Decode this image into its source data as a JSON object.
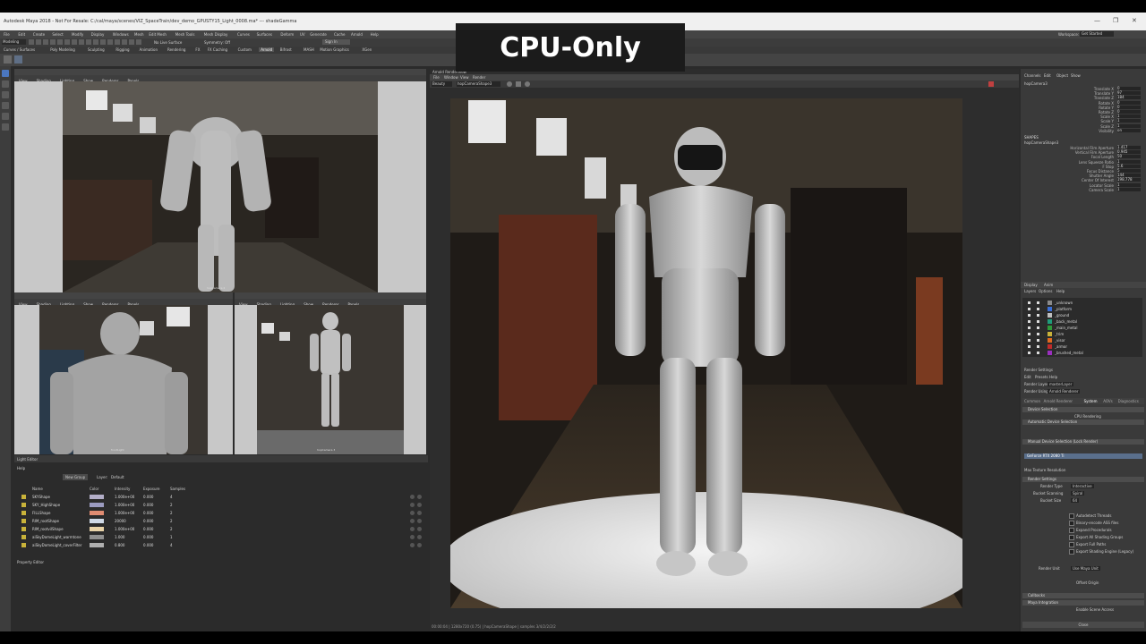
{
  "window": {
    "title": "Autodesk Maya 2018 - Not For Resale: C:/cal/maya/scenes/VIZ_SpaceTrain/dev_demo_GPUSTY15_Light_0008.ma*  ---  shadeGamma",
    "controls": [
      "—",
      "❐",
      "✕"
    ]
  },
  "menubar": {
    "items": [
      "File",
      "Edit",
      "Create",
      "Select",
      "Modify",
      "Display",
      "Windows",
      "Mesh",
      "Edit Mesh",
      "Mesh Tools",
      "Mesh Display",
      "Curves",
      "Surfaces",
      "Deform",
      "UV",
      "Generate",
      "Cache",
      "Arnold",
      "Help"
    ],
    "workspace_label": "Workspace:",
    "workspace_value": "Get Started"
  },
  "statusline": {
    "mode": "Modeling",
    "no_live": "No Live Surface",
    "symmetry": "Symmetry: Off",
    "signin": "Sign In"
  },
  "shelf": {
    "tabs": [
      "Curves / Surfaces",
      "Poly Modeling",
      "Sculpting",
      "Rigging",
      "Animation",
      "Rendering",
      "FX",
      "FX Caching",
      "Custom",
      "Arnold",
      "Bifrost",
      "MASH",
      "Motion Graphics",
      "XGen"
    ],
    "active": "Arnold"
  },
  "viewports": {
    "top": {
      "menu": [
        "View",
        "Shading",
        "Lighting",
        "Show",
        "Renderer",
        "Panels"
      ],
      "camera": "hopCamera 2"
    },
    "bottom_left": {
      "menu": [
        "View",
        "Shading",
        "Lighting",
        "Show",
        "Renderer",
        "Panels"
      ],
      "camera": "frontLight"
    },
    "bottom_right": {
      "menu": [
        "View",
        "Shading",
        "Lighting",
        "Show",
        "Renderer",
        "Panels"
      ],
      "camera": "hopCamera 3"
    }
  },
  "overlay": {
    "label": "CPU-Only"
  },
  "render_view": {
    "title": "Arnold RenderView",
    "menu": [
      "File",
      "Window",
      "View",
      "Render"
    ],
    "camera_select": "hopCameraShape3",
    "aov": "Beauty",
    "status": "00:00:04 | 1280x720 (0.75) | hopCameraShape | samples 3/4/2/2/2/2"
  },
  "light_editor": {
    "title": "Light Editor",
    "menu": "Help",
    "new_group": "New Group",
    "layer_label": "Layer:",
    "layer_value": "Default",
    "columns": [
      "Name",
      "Color",
      "Intensity",
      "Exposure",
      "Samples"
    ],
    "rows": [
      {
        "name": "SKYShape",
        "color": "#b3aec8",
        "intensity": "1.000e+00",
        "exposure": "0.000",
        "samples": "4"
      },
      {
        "name": "SKY_HighShape",
        "color": "#9b9bc0",
        "intensity": "1.000e+00",
        "exposure": "0.000",
        "samples": "2"
      },
      {
        "name": "FILLShape",
        "color": "#e08c72",
        "intensity": "1.000e+00",
        "exposure": "0.000",
        "samples": "2"
      },
      {
        "name": "RIM_rootShape",
        "color": "#cfd9e6",
        "intensity": "20000",
        "exposure": "0.000",
        "samples": "2"
      },
      {
        "name": "RIM_rootvilShape",
        "color": "#e8d3a8",
        "intensity": "1.000e+00",
        "exposure": "0.000",
        "samples": "2"
      },
      {
        "name": "aiSkyDomeLight_warmtone",
        "color": "#8f8f8f",
        "intensity": "1.000",
        "exposure": "0.000",
        "samples": "1"
      },
      {
        "name": "aiSkyDomeLight_coverFilter",
        "color": "#b0b0b0",
        "intensity": "0.800",
        "exposure": "0.000",
        "samples": "4"
      }
    ]
  },
  "property_editor": {
    "title": "Property Editor"
  },
  "channel_box": {
    "tabs": [
      "Channels",
      "Edit",
      "Object",
      "Show"
    ],
    "object": "hopCamera3",
    "channels": [
      {
        "name": "Translate X",
        "value": "0"
      },
      {
        "name": "Translate Y",
        "value": "97"
      },
      {
        "name": "Translate Z",
        "value": "184"
      },
      {
        "name": "Rotate X",
        "value": "0"
      },
      {
        "name": "Rotate Y",
        "value": "0"
      },
      {
        "name": "Rotate Z",
        "value": "0"
      },
      {
        "name": "Scale X",
        "value": "1"
      },
      {
        "name": "Scale Y",
        "value": "1"
      },
      {
        "name": "Scale Z",
        "value": "1"
      },
      {
        "name": "Visibility",
        "value": "on"
      }
    ],
    "shapes_label": "SHAPES",
    "shape_name": "hopCameraShape3",
    "shape_channels": [
      {
        "name": "Horizontal Film Aperture",
        "value": "1.417"
      },
      {
        "name": "Vertical Film Aperture",
        "value": "0.945"
      },
      {
        "name": "Focal Length",
        "value": "50"
      },
      {
        "name": "Lens Squeeze Ratio",
        "value": "1"
      },
      {
        "name": "F Stop",
        "value": "5.6"
      },
      {
        "name": "Focus Distance",
        "value": "5"
      },
      {
        "name": "Shutter Angle",
        "value": "144"
      },
      {
        "name": "Center Of Interest",
        "value": "198.778"
      },
      {
        "name": "Locator Scale",
        "value": "1"
      },
      {
        "name": "Camera Scale",
        "value": "1"
      }
    ]
  },
  "layers": {
    "tabs": [
      "Display",
      "Anim"
    ],
    "menu": [
      "Layers",
      "Options",
      "Help"
    ],
    "items": [
      {
        "name": "_unknown",
        "color": "#8a8a8a"
      },
      {
        "name": "_platform",
        "color": "#3a6fd8"
      },
      {
        "name": "_ground",
        "color": "#bfbfbf"
      },
      {
        "name": "_back_metal",
        "color": "#1f9c7c"
      },
      {
        "name": "_main_metal",
        "color": "#2f9a3a"
      },
      {
        "name": "_trim",
        "color": "#c9b23a"
      },
      {
        "name": "_visor",
        "color": "#e06a20"
      },
      {
        "name": "_armor",
        "color": "#c22a2a"
      },
      {
        "name": "_brushed_metal",
        "color": "#9b2fbf"
      }
    ]
  },
  "render_settings": {
    "title": "Render Settings",
    "menu": [
      "Edit",
      "Presets",
      "Help"
    ],
    "render_layer_label": "Render Layer",
    "render_layer_value": "masterLayer",
    "render_using_label": "Render Using",
    "render_using_value": "Arnold Renderer",
    "tabs": [
      "Common",
      "Arnold Renderer",
      "System",
      "AOVs",
      "Diagnostics"
    ],
    "active_tab": "System",
    "sections": [
      {
        "label": "Device Selection"
      },
      {
        "label": "Automatic Device Selection"
      },
      {
        "label": "Manual Device Selection (Lock Render)"
      },
      {
        "label": "Render Settings"
      },
      {
        "label": "Callbacks"
      },
      {
        "label": "Maya Integration"
      }
    ],
    "cpu_rendering": "CPU Rendering",
    "gpu_device": "GeForce RTX 2080 Ti",
    "max_texture_resolution": "Max Texture Resolution",
    "render_type_label": "Render Type",
    "render_type_value": "Interactive",
    "bucket_scanning_label": "Bucket Scanning",
    "bucket_scanning_value": "Spiral",
    "bucket_size_label": "Bucket Size",
    "bucket_size_value": "64",
    "checkboxes": [
      "Autodetect Threads",
      "Binary-encode ASS files",
      "Expand Procedurals",
      "Export All Shading Groups",
      "Export Full Paths",
      "Export Shading Engine (Legacy)"
    ],
    "render_unit_label": "Render Unit",
    "render_unit_value": "Use Maya Unit",
    "offset_origin": "Offset Origin",
    "enable_scene_access": "Enable Scene Access",
    "close": "Close"
  }
}
